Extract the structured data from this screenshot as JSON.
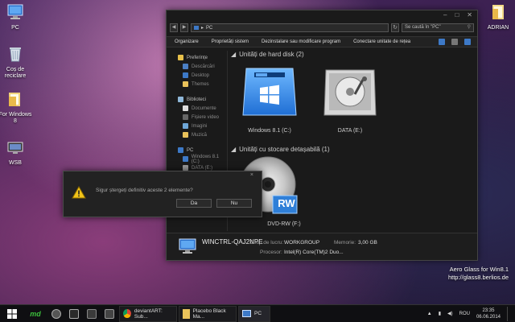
{
  "desktop": {
    "icons": [
      {
        "label": "PC",
        "icon": "pc-icon"
      },
      {
        "label": "Coș de reciclare",
        "icon": "recycle-bin-icon"
      },
      {
        "label": "For Windows 8",
        "icon": "folder-icon"
      },
      {
        "label": "WSB",
        "icon": "monitor-icon"
      },
      {
        "label": "ADRIAN",
        "icon": "user-folder-icon"
      }
    ]
  },
  "explorer": {
    "address": "PC",
    "search_placeholder": "Se caută în \"PC\"",
    "toolbar": [
      "Organizare",
      "Proprietăți sistem",
      "Dezinstalare sau modificare program",
      "Conectare unitate de rețea"
    ],
    "nav": {
      "favorites_header": "Preferințe",
      "favorites": [
        "Descărcări",
        "Desktop",
        "Themes"
      ],
      "libraries_header": "Biblioteci",
      "libraries": [
        "Documente",
        "Fișiere video",
        "Imagini",
        "Muzică"
      ],
      "pc_header": "PC",
      "pc_items": [
        "Windows 8.1 (C:)",
        "DATA (E:)"
      ]
    },
    "groups": {
      "hard_disks": "Unități de hard disk (2)",
      "removable": "Unități cu stocare detașabilă (1)"
    },
    "drives": [
      {
        "label": "Windows 8.1 (C:)"
      },
      {
        "label": "DATA (E:)"
      },
      {
        "label": "DVD-RW (F:)",
        "badge": "RW"
      }
    ],
    "details": {
      "name": "WINCTRL-QAJ2NPE",
      "workgroup_label": "Grup de lucru:",
      "workgroup": "WORKGROUP",
      "memory_label": "Memorie:",
      "memory": "3,00 GB",
      "processor_label": "Procesor:",
      "processor": "Intel(R) Core(TM)2 Duo..."
    }
  },
  "dialog": {
    "message": "Sigur ștergeți definitiv aceste 2 elemente?",
    "yes": "Da",
    "no": "Nu",
    "close": "×"
  },
  "watermark": {
    "line1": "Aero Glass for Win8.1",
    "line2": "http://glass8.berlios.de"
  },
  "taskbar": {
    "tasks": [
      {
        "label": "deviantART: Sub...",
        "icon": "chrome-icon"
      },
      {
        "label": "Placebo Black Ma...",
        "icon": "folder-icon"
      },
      {
        "label": "PC",
        "icon": "pc-icon"
      }
    ],
    "language": "ROU",
    "time": "23:35",
    "date": "06.06.2014"
  },
  "colors": {
    "accent": "#3d79c7",
    "folder": "#e9c25a",
    "window_bg": "#1a1a1a"
  }
}
